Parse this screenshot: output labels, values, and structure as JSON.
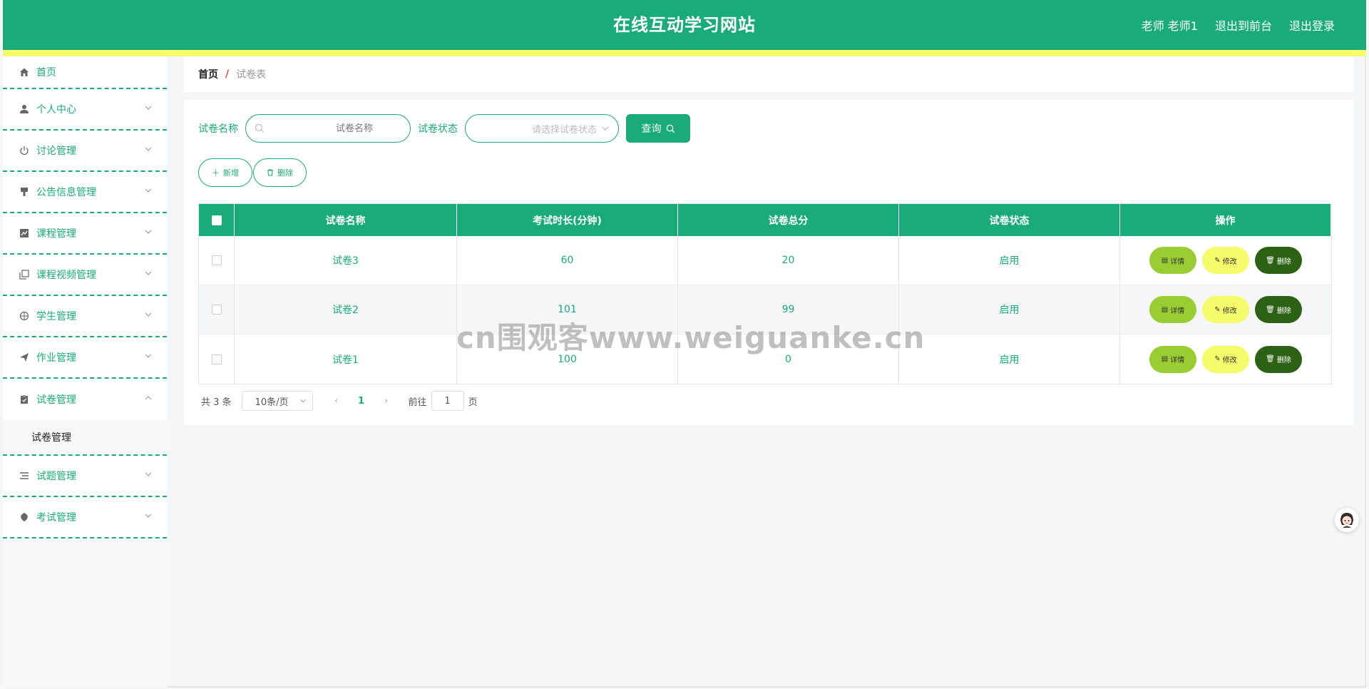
{
  "header": {
    "title": "在线互动学习网站",
    "user": "老师 老师1",
    "to_front": "退出到前台",
    "logout": "退出登录"
  },
  "sidebar": {
    "items": [
      {
        "label": "首页",
        "icon": "home-icon"
      },
      {
        "label": "个人中心",
        "icon": "user-icon"
      },
      {
        "label": "讨论管理",
        "icon": "power-icon"
      },
      {
        "label": "公告信息管理",
        "icon": "brush-icon"
      },
      {
        "label": "课程管理",
        "icon": "chart-icon"
      },
      {
        "label": "课程视频管理",
        "icon": "copy-icon"
      },
      {
        "label": "学生管理",
        "icon": "compass-icon"
      },
      {
        "label": "作业管理",
        "icon": "send-icon"
      },
      {
        "label": "试卷管理",
        "icon": "clipboard-icon",
        "sub": "试卷管理"
      },
      {
        "label": "试题管理",
        "icon": "list-icon"
      },
      {
        "label": "考试管理",
        "icon": "shield-icon"
      }
    ]
  },
  "breadcrumb": {
    "home": "首页",
    "sep": "/",
    "current": "试卷表"
  },
  "search": {
    "name_label": "试卷名称",
    "name_placeholder": "试卷名称",
    "status_label": "试卷状态",
    "status_placeholder": "请选择试卷状态",
    "query": "查询"
  },
  "actions": {
    "add": "新增",
    "delete": "删除"
  },
  "table": {
    "headers": [
      "试卷名称",
      "考试时长(分钟)",
      "试卷总分",
      "试卷状态",
      "操作"
    ],
    "rows": [
      {
        "name": "试卷3",
        "duration": "60",
        "score": "20",
        "status": "启用"
      },
      {
        "name": "试卷2",
        "duration": "101",
        "score": "99",
        "status": "启用"
      },
      {
        "name": "试卷1",
        "duration": "100",
        "score": "0",
        "status": "启用"
      }
    ],
    "ops": {
      "detail": "详情",
      "edit": "修改",
      "delete": "删除"
    }
  },
  "pager": {
    "total": "共 3 条",
    "page_size": "10条/页",
    "current": "1",
    "goto_prefix": "前往",
    "goto_value": "1",
    "goto_suffix": "页"
  },
  "watermark": "cn围观客www.weiguanke.cn",
  "colors": {
    "primary": "#1aab7a",
    "accent_yellow": "#f6fb6b",
    "detail": "#9acd32",
    "delete": "#2d6114"
  }
}
